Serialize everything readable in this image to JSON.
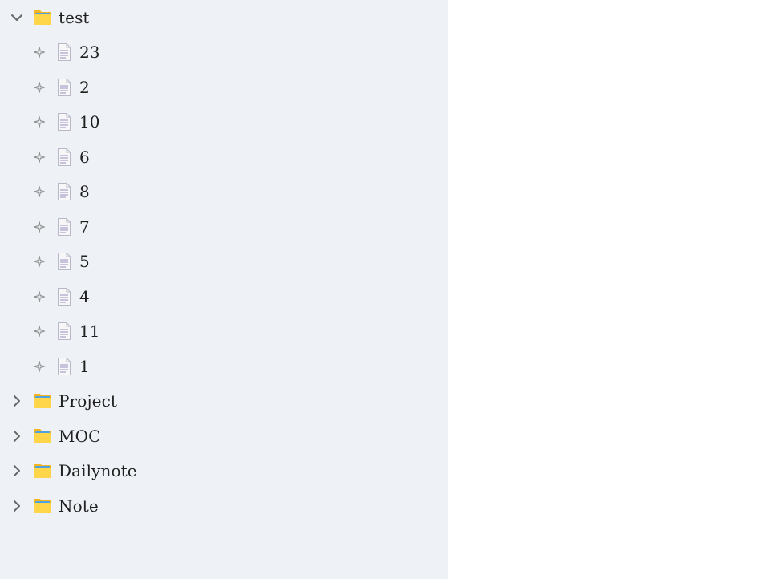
{
  "tree": {
    "open_folder": {
      "label": "test",
      "icon": "folder-icon",
      "expanded": true
    },
    "files": [
      {
        "label": "23"
      },
      {
        "label": "2"
      },
      {
        "label": "10"
      },
      {
        "label": "6"
      },
      {
        "label": "8"
      },
      {
        "label": "7"
      },
      {
        "label": "5"
      },
      {
        "label": "4"
      },
      {
        "label": "11"
      },
      {
        "label": "1"
      }
    ],
    "closed_folders": [
      {
        "label": "Project",
        "expanded": false
      },
      {
        "label": "MOC",
        "expanded": false
      },
      {
        "label": "Dailynote",
        "expanded": false
      },
      {
        "label": "Note",
        "expanded": false
      }
    ]
  },
  "colors": {
    "sidebar_bg": "#eef2f6",
    "folder_yellow": "#ffcf3f",
    "folder_tab": "#f5a623",
    "chevron": "#555555",
    "text": "#1f1f1f"
  }
}
